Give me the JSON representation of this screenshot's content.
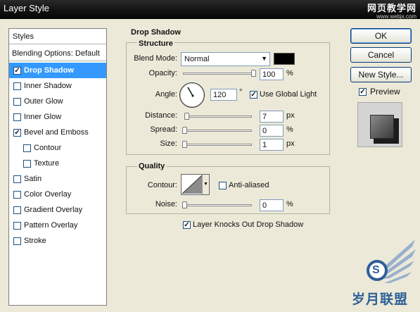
{
  "window": {
    "title": "Layer Style"
  },
  "watermark_top": {
    "cn": "网页教学网",
    "url": "www.webjx.com"
  },
  "styles_panel": {
    "header": "Styles",
    "blending_options": "Blending Options: Default",
    "items": [
      {
        "label": "Drop Shadow",
        "checked": true,
        "selected": true,
        "mark": "✓"
      },
      {
        "label": "Inner Shadow",
        "checked": false,
        "mark": ""
      },
      {
        "label": "Outer Glow",
        "checked": false,
        "mark": ""
      },
      {
        "label": "Inner Glow",
        "checked": false,
        "mark": ""
      },
      {
        "label": "Bevel and Emboss",
        "checked": true,
        "mark": "✓"
      },
      {
        "label": "Contour",
        "checked": false,
        "sub": true,
        "mark": ""
      },
      {
        "label": "Texture",
        "checked": false,
        "sub": true,
        "mark": ""
      },
      {
        "label": "Satin",
        "checked": false,
        "mark": ""
      },
      {
        "label": "Color Overlay",
        "checked": false,
        "mark": ""
      },
      {
        "label": "Gradient Overlay",
        "checked": false,
        "mark": ""
      },
      {
        "label": "Pattern Overlay",
        "checked": false,
        "mark": ""
      },
      {
        "label": "Stroke",
        "checked": false,
        "mark": ""
      }
    ]
  },
  "drop_shadow": {
    "section_title": "Drop Shadow",
    "structure": {
      "title": "Structure",
      "blend_mode_label": "Blend Mode:",
      "blend_mode_value": "Normal",
      "shadow_color": "#000000",
      "opacity_label": "Opacity:",
      "opacity_value": "100",
      "opacity_unit": "%",
      "opacity_fraction": 1.0,
      "angle_label": "Angle:",
      "angle_value": "120",
      "angle_unit": "°",
      "angle_degrees": 120,
      "use_global_light_label": "Use Global Light",
      "use_global_light_mark": "✓",
      "distance_label": "Distance:",
      "distance_value": "7",
      "distance_unit": "px",
      "distance_fraction": 0.03,
      "spread_label": "Spread:",
      "spread_value": "0",
      "spread_unit": "%",
      "spread_fraction": 0.0,
      "size_label": "Size:",
      "size_value": "1",
      "size_unit": "px",
      "size_fraction": 0.004
    },
    "quality": {
      "title": "Quality",
      "contour_label": "Contour:",
      "anti_aliased_label": "Anti-aliased",
      "anti_aliased_mark": "",
      "noise_label": "Noise:",
      "noise_value": "0",
      "noise_unit": "%",
      "noise_fraction": 0.0
    },
    "knockout_label": "Layer Knocks Out Drop Shadow",
    "knockout_mark": "✓"
  },
  "buttons": {
    "ok": "OK",
    "cancel": "Cancel",
    "new_style": "New Style..."
  },
  "preview": {
    "label": "Preview",
    "mark": "✓"
  },
  "watermark_logo": {
    "text": "岁月联盟",
    "badge": "S"
  }
}
